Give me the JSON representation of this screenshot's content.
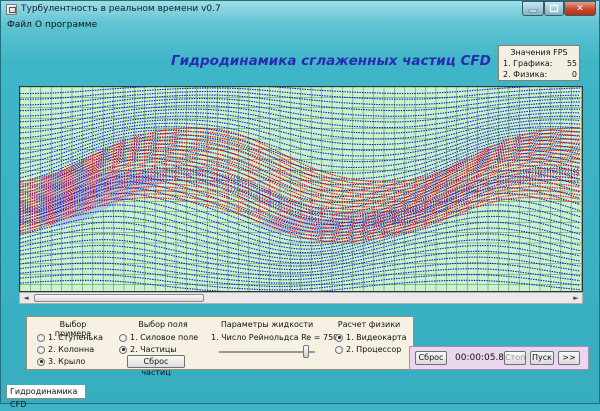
{
  "window": {
    "title": "Турбулентность в реальном времени v0.7",
    "close_glyph": "✕"
  },
  "menu": [
    "Файл",
    "О программе"
  ],
  "heading": "Гидродинамика сглаженных частиц CFD",
  "fps": {
    "title": "Значения FPS",
    "rows": [
      {
        "label": "1. Графика:",
        "value": "55"
      },
      {
        "label": "2. Физика:",
        "value": "0"
      }
    ]
  },
  "colors": {
    "fluid_primary": "#1010e0",
    "fluid_secondary": "#ee1010",
    "solid_region": "#a8cfdc",
    "grid_fill": "#c9f2cd",
    "grid_line": "#2d7a38"
  },
  "scrollbar": {
    "left_arrow": "◄",
    "right_arrow": "►"
  },
  "controls": {
    "example": {
      "heading": "Выбор примера",
      "options": [
        {
          "label": "1. Ступенька",
          "selected": false
        },
        {
          "label": "2. Колонна",
          "selected": false
        },
        {
          "label": "3. Крыло",
          "selected": true
        }
      ]
    },
    "field": {
      "heading": "Выбор поля",
      "options": [
        {
          "label": "1. Силовое поле",
          "selected": false
        },
        {
          "label": "2. Частицы",
          "selected": true
        }
      ],
      "reset_particles": "Сброс частиц"
    },
    "fluid": {
      "heading": "Параметры жидкости",
      "reynolds_label": "1. Число Рейнольдса Re = 750",
      "reynolds_value": 750
    },
    "physics": {
      "heading": "Расчет физики",
      "options": [
        {
          "label": "1. Видеокарта",
          "selected": true
        },
        {
          "label": "2. Процессор",
          "selected": false
        }
      ]
    }
  },
  "timer": {
    "reset": "Сброс",
    "time": "00:00:05.84",
    "stop": "Стоп",
    "start": "Пуск",
    "step": ">>"
  },
  "tab": "Гидродинамика CFD"
}
